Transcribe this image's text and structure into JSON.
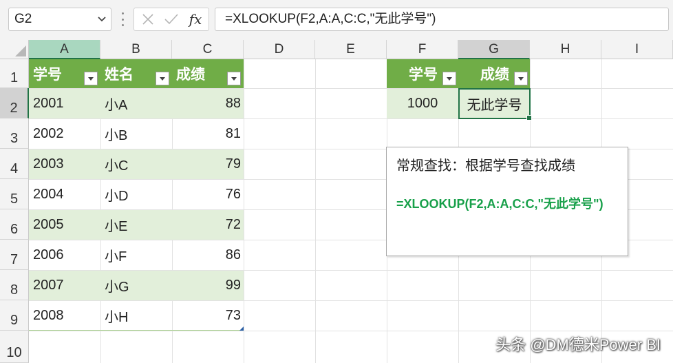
{
  "formula_bar": {
    "name_box": "G2",
    "formula": "=XLOOKUP(F2,A:A,C:C,\"无此学号\")",
    "fx_label": "fx"
  },
  "columns": [
    "A",
    "B",
    "C",
    "D",
    "E",
    "F",
    "G",
    "H",
    "I"
  ],
  "rows": [
    "1",
    "2",
    "3",
    "4",
    "5",
    "6",
    "7",
    "8",
    "9",
    "10"
  ],
  "table": {
    "headers": [
      "学号",
      "姓名",
      "成绩"
    ],
    "rows": [
      [
        "2001",
        "小A",
        "88"
      ],
      [
        "2002",
        "小B",
        "81"
      ],
      [
        "2003",
        "小C",
        "79"
      ],
      [
        "2004",
        "小D",
        "76"
      ],
      [
        "2005",
        "小E",
        "72"
      ],
      [
        "2006",
        "小F",
        "86"
      ],
      [
        "2007",
        "小G",
        "99"
      ],
      [
        "2008",
        "小H",
        "73"
      ]
    ]
  },
  "lookup": {
    "headers": [
      "学号",
      "成绩"
    ],
    "values": [
      "1000",
      "无此学号"
    ]
  },
  "note": {
    "title": "常规查找：根据学号查找成绩",
    "formula": "=XLOOKUP(F2,A:A,C:C,\"无此学号\")"
  },
  "watermark": "头条 @DM德米Power BI",
  "colors": {
    "header_green": "#70ad47",
    "band_green": "#e2efda",
    "excel_green": "#217346",
    "formula_green": "#18a04a"
  }
}
